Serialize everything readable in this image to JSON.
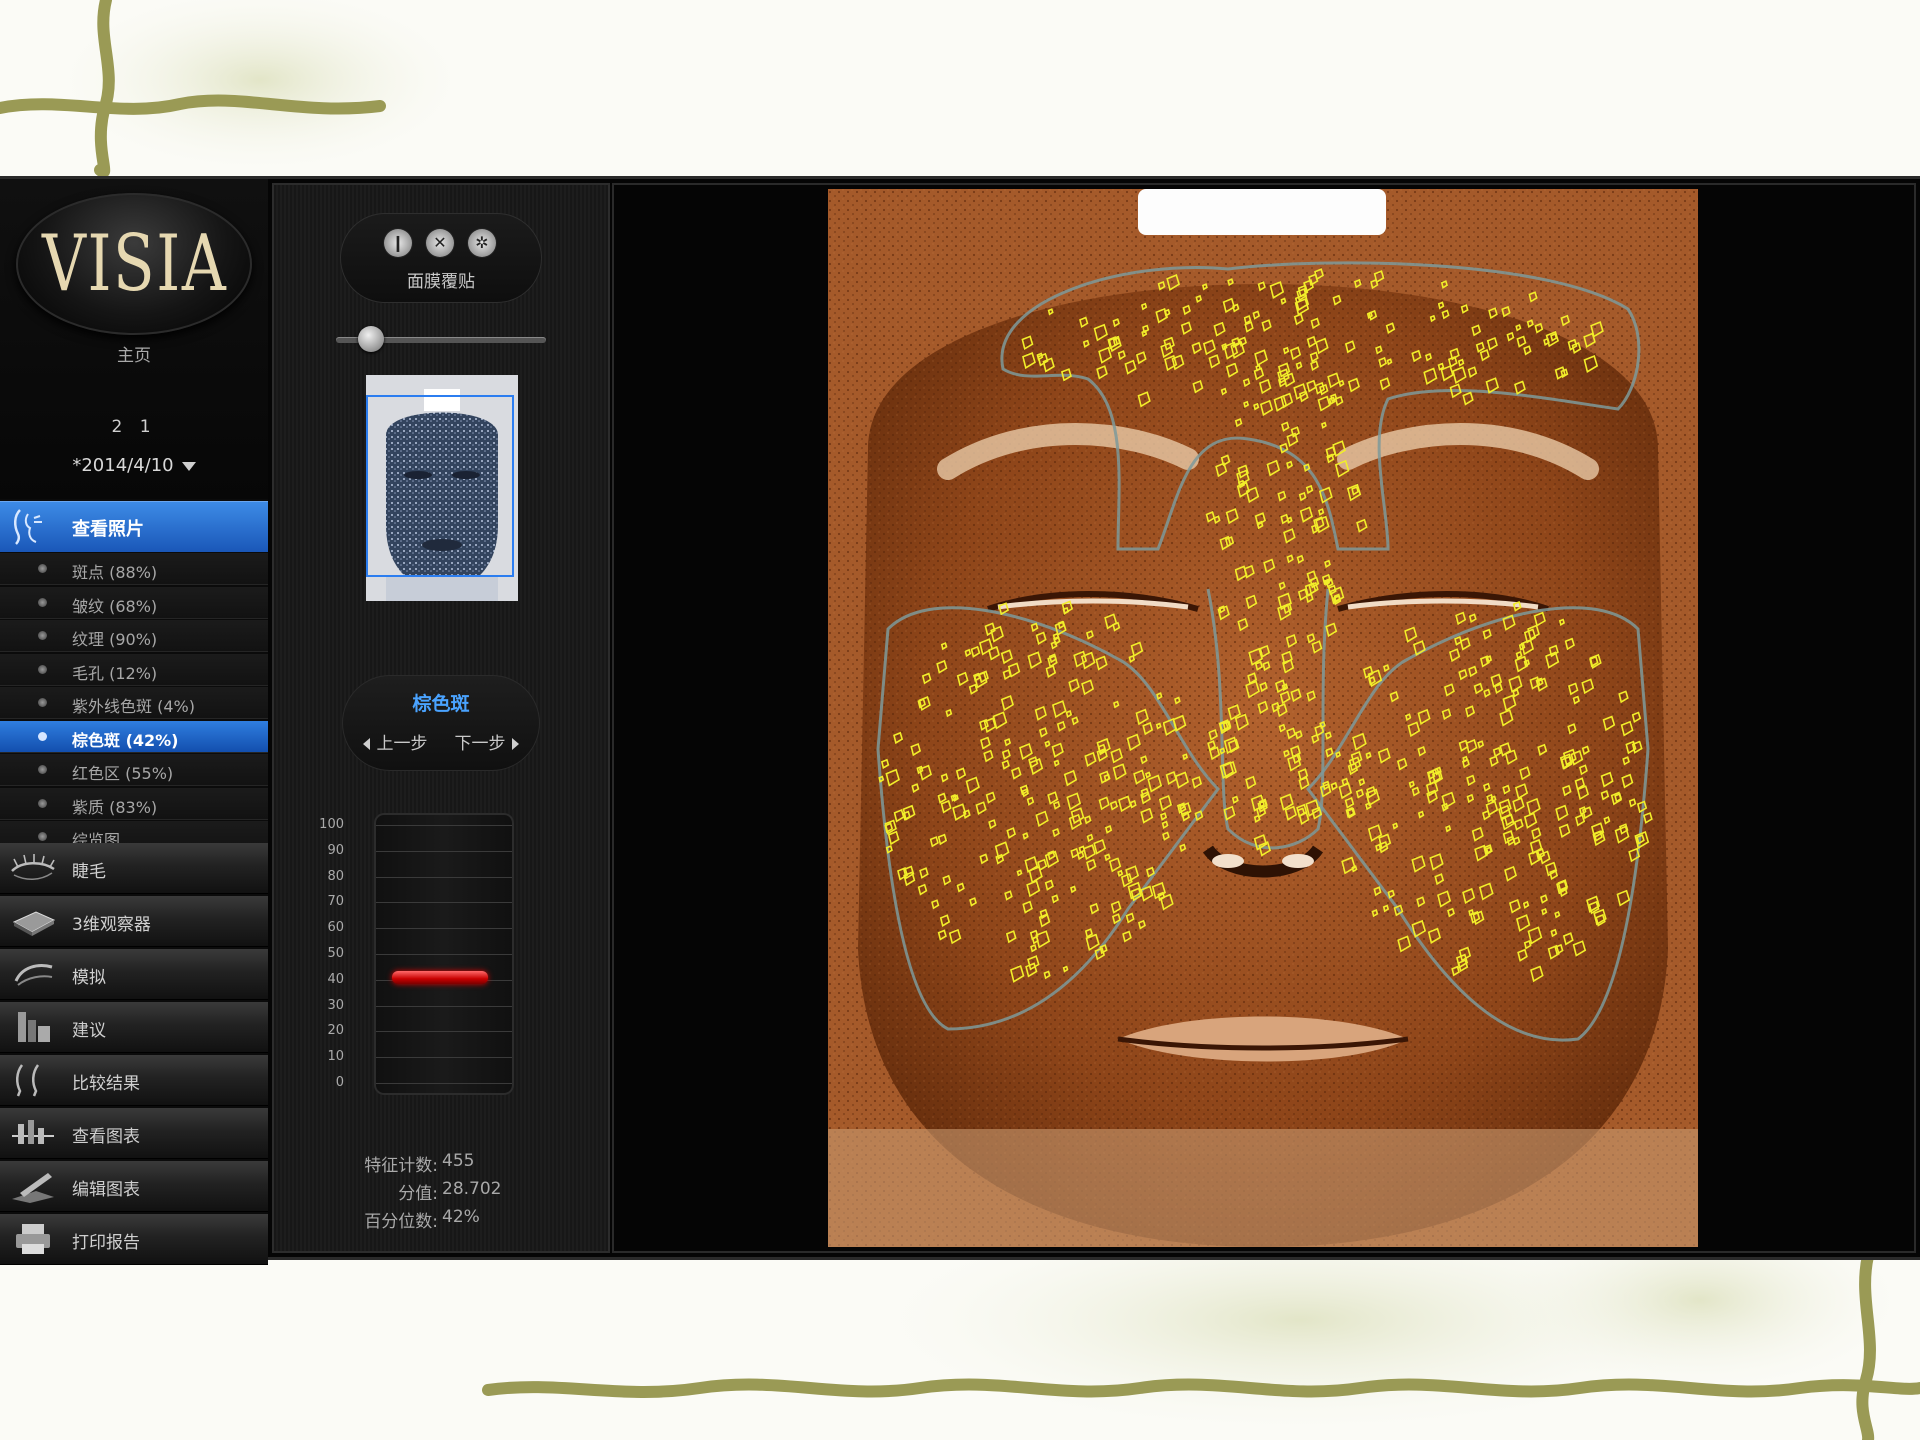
{
  "nav": {
    "logo": "VISIA",
    "home": "主页",
    "patient_id": "2 1",
    "visit_date": "*2014/4/10",
    "view_photos": "查看照片",
    "features": [
      {
        "label": "斑点 (88%)",
        "active": false
      },
      {
        "label": "皱纹 (68%)",
        "active": false
      },
      {
        "label": "纹理 (90%)",
        "active": false
      },
      {
        "label": "毛孔 (12%)",
        "active": false
      },
      {
        "label": "紫外线色斑 (4%)",
        "active": false
      },
      {
        "label": "棕色斑 (42%)",
        "active": true
      },
      {
        "label": "红色区 (55%)",
        "active": false
      },
      {
        "label": "紫质 (83%)",
        "active": false
      },
      {
        "label": "综览图",
        "active": false
      }
    ],
    "tools": [
      {
        "label": "睫毛",
        "icon": "eyelash-icon"
      },
      {
        "label": "3维观察器",
        "icon": "3d-viewer-icon"
      },
      {
        "label": "模拟",
        "icon": "simulation-icon"
      },
      {
        "label": "建议",
        "icon": "recommendation-icon"
      },
      {
        "label": "比较结果",
        "icon": "compare-icon"
      },
      {
        "label": "查看图表",
        "icon": "view-chart-icon"
      },
      {
        "label": "编辑图表",
        "icon": "edit-chart-icon"
      },
      {
        "label": "打印报告",
        "icon": "printer-icon"
      }
    ]
  },
  "panel": {
    "mask_label": "面膜覆贴",
    "feature_name": "棕色斑",
    "prev": "上一步",
    "next": "下一步",
    "gauge_ticks": [
      "100",
      "90",
      "80",
      "70",
      "60",
      "50",
      "40",
      "30",
      "20",
      "10",
      "0"
    ],
    "gauge_value": 41,
    "stats": {
      "count_label": "特征计数:",
      "count_value": "455",
      "score_label": "分值:",
      "score_value": "28.702",
      "percentile_label": "百分位数:",
      "percentile_value": "42%"
    }
  },
  "colors": {
    "accent": "#2b7df0",
    "feature_title": "#4aa3ff",
    "gauge_marker": "#d40000",
    "spot_outline": "#f2ee2a"
  }
}
